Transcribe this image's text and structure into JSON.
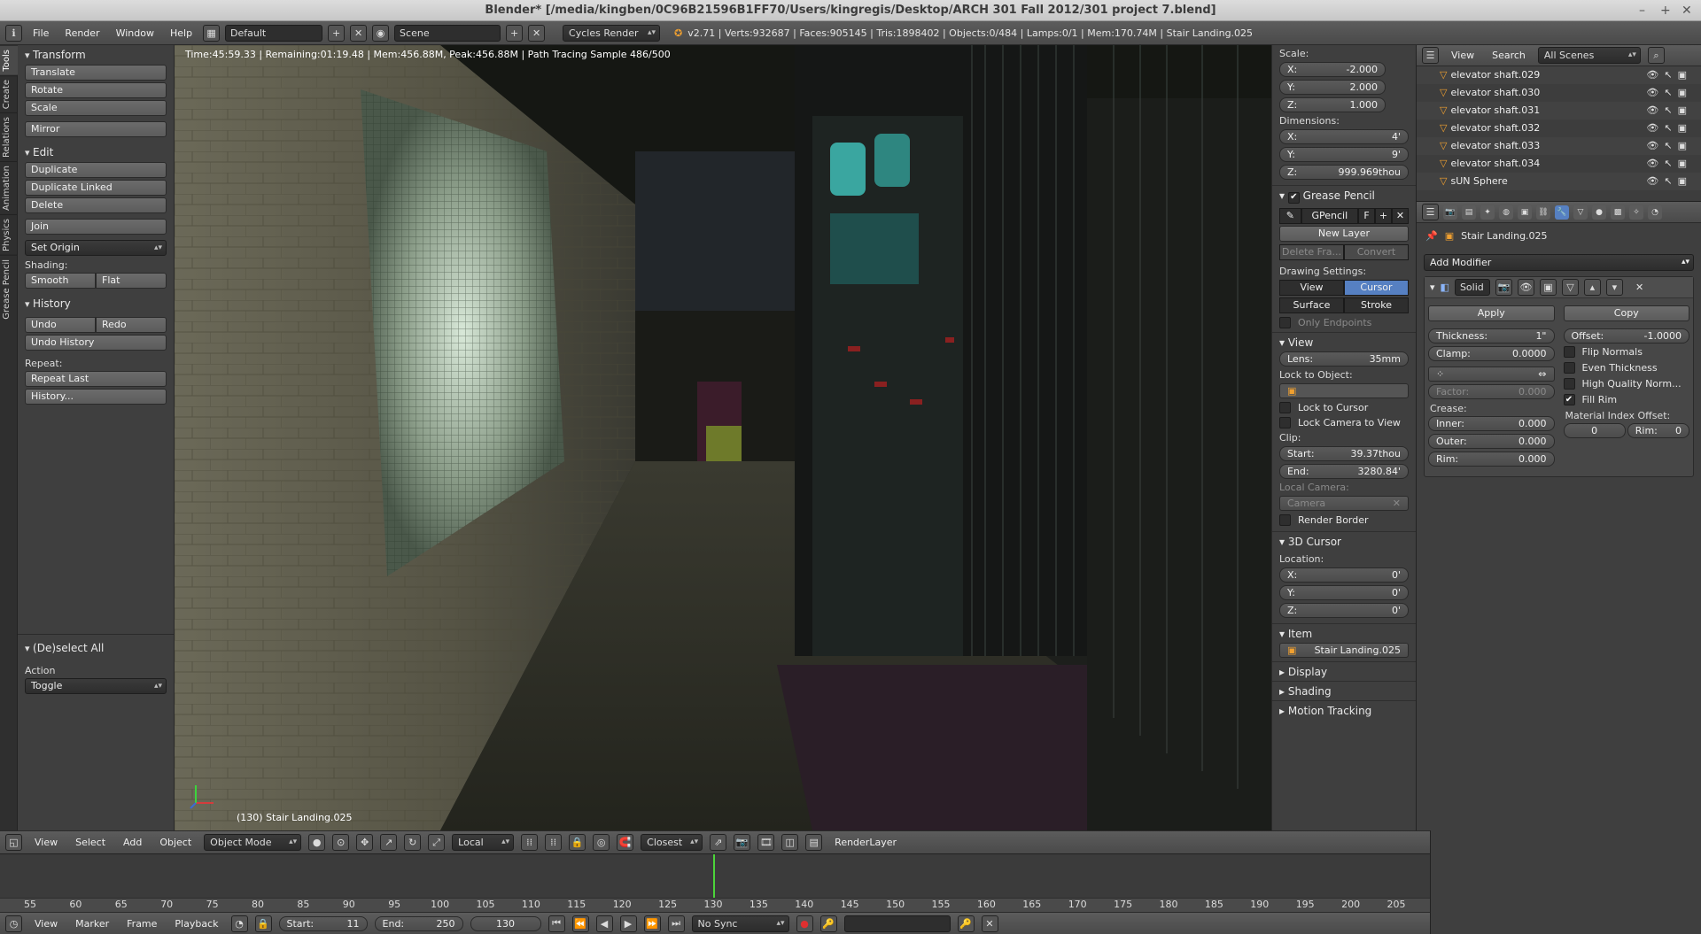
{
  "window": {
    "title": "Blender* [/media/kingben/0C96B21596B1FF70/Users/kingregis/Desktop/ARCH 301 Fall 2012/301 project 7.blend]",
    "controls": [
      "–",
      "+",
      "✕"
    ]
  },
  "info_header": {
    "menus": [
      "File",
      "Render",
      "Window",
      "Help"
    ],
    "layout": "Default",
    "scene": "Scene",
    "engine": "Cycles Render",
    "stats": "v2.71 | Verts:932687 | Faces:905145 | Tris:1898402 | Objects:0/484 | Lamps:0/1 | Mem:170.74M | Stair Landing.025"
  },
  "tabs": [
    "Tools",
    "Create",
    "Relations",
    "Animation",
    "Physics",
    "Grease Pencil"
  ],
  "toolshelf": {
    "transform_title": "Transform",
    "translate": "Translate",
    "rotate": "Rotate",
    "scale": "Scale",
    "mirror": "Mirror",
    "edit_title": "Edit",
    "duplicate": "Duplicate",
    "duplicate_linked": "Duplicate Linked",
    "delete": "Delete",
    "join": "Join",
    "set_origin": "Set Origin",
    "shading_label": "Shading:",
    "smooth": "Smooth",
    "flat": "Flat",
    "history_title": "History",
    "undo": "Undo",
    "redo": "Redo",
    "undo_history": "Undo History",
    "repeat_label": "Repeat:",
    "repeat_last": "Repeat Last",
    "history_dots": "History..."
  },
  "operator_panel": {
    "title": "(De)select All",
    "action_label": "Action",
    "action_value": "Toggle"
  },
  "viewport": {
    "render_info": "Time:45:59.33 | Remaining:01:19.48 | Mem:456.88M, Peak:456.88M | Path Tracing Sample 486/500",
    "object_label": "(130) Stair Landing.025"
  },
  "npanel": {
    "scale_label": "Scale:",
    "scale": [
      {
        "axis": "X:",
        "value": "-2.000"
      },
      {
        "axis": "Y:",
        "value": "2.000"
      },
      {
        "axis": "Z:",
        "value": "1.000"
      }
    ],
    "dimensions_label": "Dimensions:",
    "dimensions": [
      {
        "axis": "X:",
        "value": "4'"
      },
      {
        "axis": "Y:",
        "value": "9'"
      },
      {
        "axis": "Z:",
        "value": "999.969thou"
      }
    ],
    "grease_pencil_title": "Grease Pencil",
    "gpencil_name": "GPencil",
    "gpencil_f": "F",
    "new_layer": "New Layer",
    "delete_frame": "Delete Fra...",
    "convert": "Convert",
    "drawing_settings": "Drawing Settings:",
    "view": "View",
    "cursor": "Cursor",
    "surface": "Surface",
    "stroke": "Stroke",
    "only_endpoints": "Only Endpoints",
    "view_title": "View",
    "lens_label": "Lens:",
    "lens_value": "35mm",
    "lock_to_object": "Lock to Object:",
    "lock_to_cursor": "Lock to Cursor",
    "lock_camera": "Lock Camera to View",
    "clip_label": "Clip:",
    "clip_start_label": "Start:",
    "clip_start": "39.37thou",
    "clip_end_label": "End:",
    "clip_end": "3280.84'",
    "local_camera": "Local Camera:",
    "camera": "Camera",
    "render_border": "Render Border",
    "cursor3d_title": "3D Cursor",
    "location_label": "Location:",
    "location": [
      {
        "axis": "X:",
        "value": "0'"
      },
      {
        "axis": "Y:",
        "value": "0'"
      },
      {
        "axis": "Z:",
        "value": "0'"
      }
    ],
    "item_title": "Item",
    "item_name": "Stair Landing.025",
    "display_title": "Display",
    "shading_title": "Shading",
    "motion_tracking": "Motion Tracking"
  },
  "outliner": {
    "view": "View",
    "search": "Search",
    "scenes": "All Scenes",
    "rows": [
      "elevator shaft.029",
      "elevator shaft.030",
      "elevator shaft.031",
      "elevator shaft.032",
      "elevator shaft.033",
      "elevator shaft.034",
      "sUN Sphere"
    ]
  },
  "properties": {
    "object_name": "Stair Landing.025",
    "add_modifier": "Add Modifier",
    "modifier_name": "Solid",
    "apply": "Apply",
    "copy": "Copy",
    "thickness_label": "Thickness:",
    "thickness": "1\"",
    "offset_label": "Offset:",
    "offset": "-1.0000",
    "clamp_label": "Clamp:",
    "clamp": "0.0000",
    "flip_normals": "Flip Normals",
    "even_thickness": "Even Thickness",
    "high_quality": "High Quality Norm...",
    "factor_label": "Factor:",
    "factor": "0.000",
    "fill_rim": "Fill Rim",
    "crease_label": "Crease:",
    "inner_label": "Inner:",
    "inner": "0.000",
    "outer_label": "Outer:",
    "outer": "0.000",
    "rim_label": "Rim:",
    "rim": "0.000",
    "mat_offset_label": "Material Index Offset:",
    "mat_offset": "0",
    "mat_rim_label": "Rim:",
    "mat_rim": "0"
  },
  "view3d_header": {
    "menus": [
      "View",
      "Select",
      "Add",
      "Object"
    ],
    "mode": "Object Mode",
    "pivot": "Local",
    "snap": "Closest",
    "render_layer": "RenderLayer"
  },
  "timeline": {
    "ticks": [
      "55",
      "60",
      "65",
      "70",
      "75",
      "80",
      "85",
      "90",
      "95",
      "100",
      "105",
      "110",
      "115",
      "120",
      "125",
      "130",
      "135",
      "140",
      "145",
      "150",
      "155",
      "160",
      "165",
      "170",
      "175",
      "180",
      "185",
      "190",
      "195",
      "200",
      "205"
    ],
    "current_frame": 130,
    "menus": [
      "View",
      "Marker",
      "Frame",
      "Playback"
    ],
    "start_label": "Start:",
    "start": "11",
    "end_label": "End:",
    "end": "250",
    "frame": "130",
    "sync": "No Sync"
  }
}
